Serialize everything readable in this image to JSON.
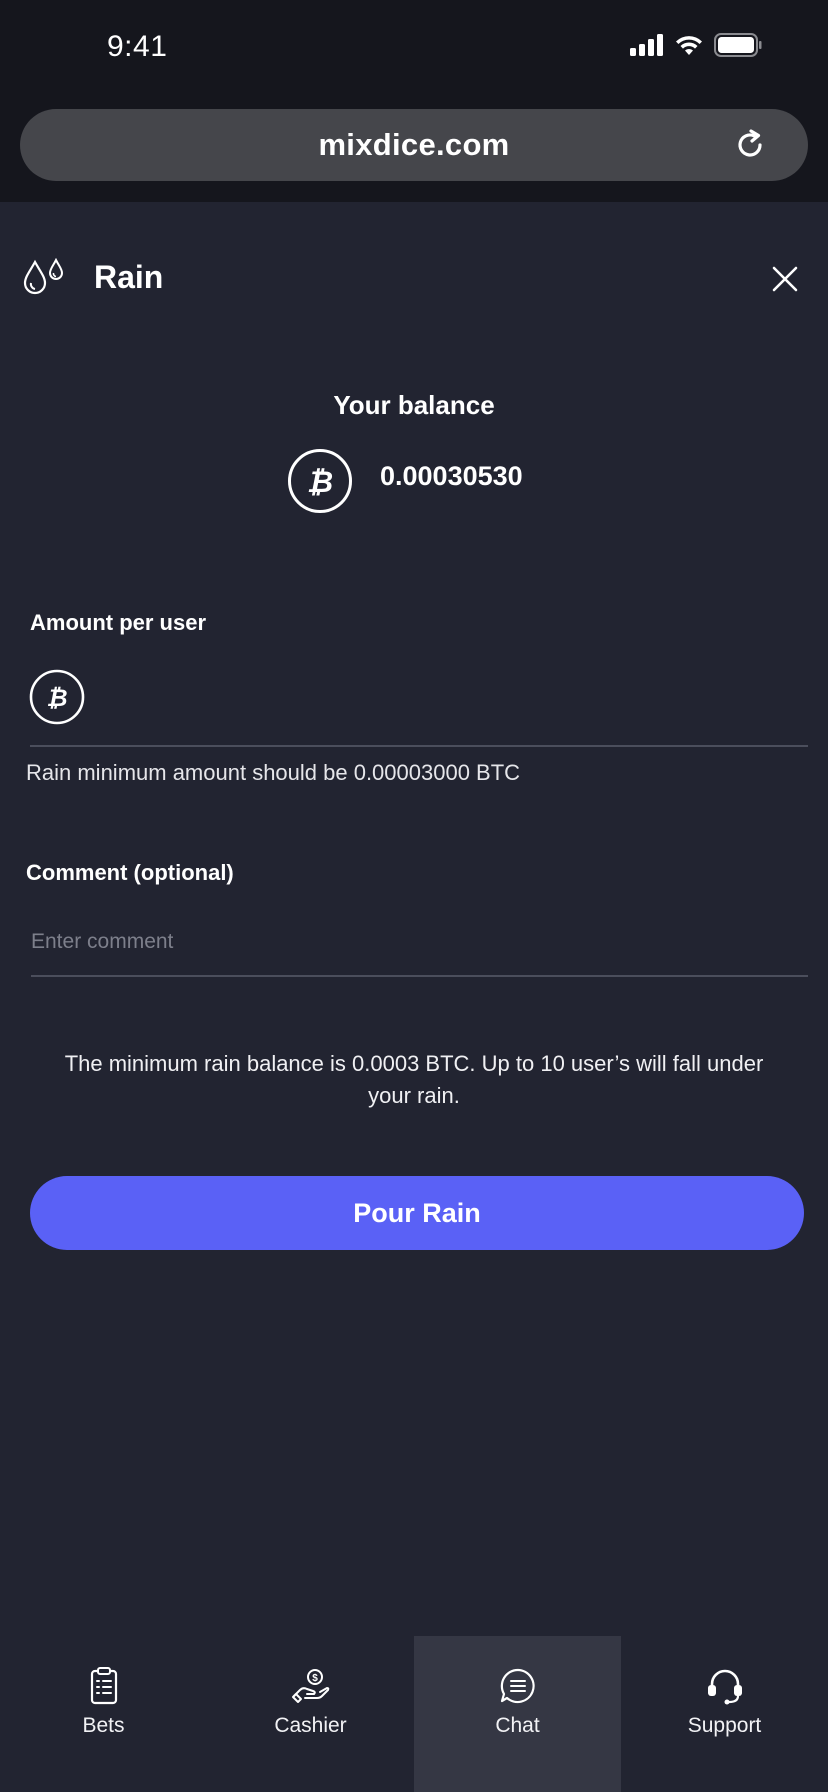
{
  "status_bar": {
    "time": "9:41"
  },
  "browser": {
    "url": "mixdice.com"
  },
  "header": {
    "title": "Rain"
  },
  "balance": {
    "label": "Your balance",
    "value": "0.00030530"
  },
  "amount": {
    "label": "Amount per user",
    "value": "",
    "hint": "Rain minimum amount should be 0.00003000 BTC"
  },
  "comment": {
    "label": "Comment (optional)",
    "placeholder": "Enter comment",
    "value": ""
  },
  "info_text": "The minimum rain balance is 0.0003 BTC. Up to 10 user’s will fall under your rain.",
  "pour_button": "Pour Rain",
  "bottom_nav": [
    {
      "label": "Bets",
      "icon": "clipboard-icon",
      "active": false
    },
    {
      "label": "Cashier",
      "icon": "hand-coin-icon",
      "active": false
    },
    {
      "label": "Chat",
      "icon": "chat-icon",
      "active": true
    },
    {
      "label": "Support",
      "icon": "headset-icon",
      "active": false
    }
  ],
  "colors": {
    "background": "#222431",
    "chrome": "#15161d",
    "accent": "#5a61f6",
    "active_tab": "#353744"
  }
}
